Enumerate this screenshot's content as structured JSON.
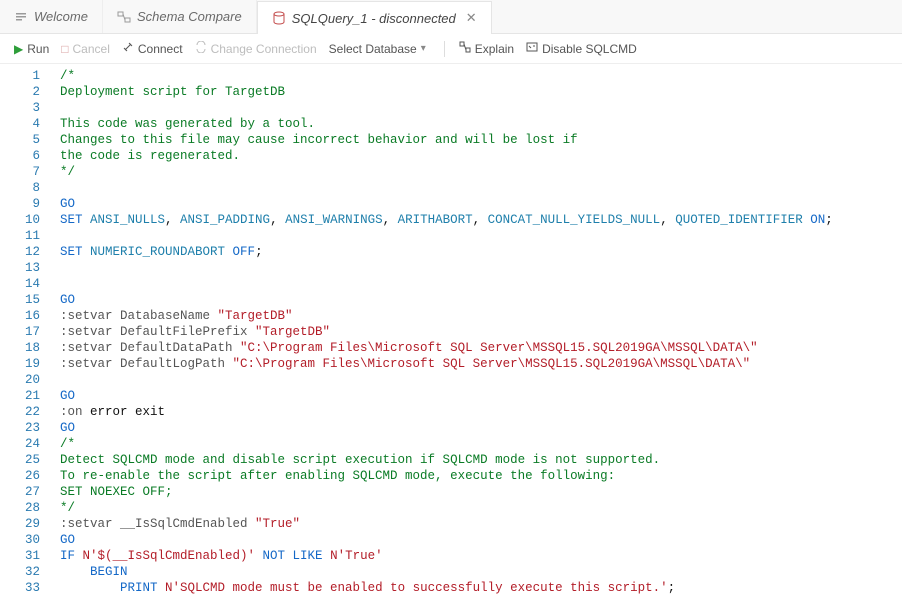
{
  "tabs": [
    {
      "label": "Welcome",
      "icon": "welcome"
    },
    {
      "label": "Schema Compare",
      "icon": "schema"
    },
    {
      "label": "SQLQuery_1 - disconnected",
      "icon": "db",
      "active": true,
      "closeable": true
    }
  ],
  "toolbar": {
    "run": "Run",
    "cancel": "Cancel",
    "connect": "Connect",
    "change_connection": "Change Connection",
    "select_database": "Select Database",
    "explain": "Explain",
    "disable_sqlcmd": "Disable SQLCMD"
  },
  "code_lines": [
    {
      "n": 1,
      "spans": [
        {
          "cls": "c-comment",
          "t": "/*"
        }
      ]
    },
    {
      "n": 2,
      "spans": [
        {
          "cls": "c-comment",
          "t": "Deployment script for TargetDB"
        }
      ]
    },
    {
      "n": 3,
      "spans": []
    },
    {
      "n": 4,
      "spans": [
        {
          "cls": "c-comment",
          "t": "This code was generated by a tool."
        }
      ]
    },
    {
      "n": 5,
      "spans": [
        {
          "cls": "c-comment",
          "t": "Changes to this file may cause incorrect behavior and will be lost if"
        }
      ]
    },
    {
      "n": 6,
      "spans": [
        {
          "cls": "c-comment",
          "t": "the code is regenerated."
        }
      ]
    },
    {
      "n": 7,
      "spans": [
        {
          "cls": "c-comment",
          "t": "*/"
        }
      ]
    },
    {
      "n": 8,
      "spans": []
    },
    {
      "n": 9,
      "spans": [
        {
          "cls": "c-kw",
          "t": "GO"
        }
      ]
    },
    {
      "n": 10,
      "spans": [
        {
          "cls": "c-kw",
          "t": "SET "
        },
        {
          "cls": "c-ident",
          "t": "ANSI_NULLS"
        },
        {
          "cls": "c-plain",
          "t": ", "
        },
        {
          "cls": "c-ident",
          "t": "ANSI_PADDING"
        },
        {
          "cls": "c-plain",
          "t": ", "
        },
        {
          "cls": "c-ident",
          "t": "ANSI_WARNINGS"
        },
        {
          "cls": "c-plain",
          "t": ", "
        },
        {
          "cls": "c-ident",
          "t": "ARITHABORT"
        },
        {
          "cls": "c-plain",
          "t": ", "
        },
        {
          "cls": "c-ident",
          "t": "CONCAT_NULL_YIELDS_NULL"
        },
        {
          "cls": "c-plain",
          "t": ", "
        },
        {
          "cls": "c-ident",
          "t": "QUOTED_IDENTIFIER"
        },
        {
          "cls": "c-kw",
          "t": " ON"
        },
        {
          "cls": "c-plain",
          "t": ";"
        }
      ]
    },
    {
      "n": 11,
      "spans": []
    },
    {
      "n": 12,
      "spans": [
        {
          "cls": "c-kw",
          "t": "SET "
        },
        {
          "cls": "c-ident",
          "t": "NUMERIC_ROUNDABORT"
        },
        {
          "cls": "c-kw",
          "t": " OFF"
        },
        {
          "cls": "c-plain",
          "t": ";"
        }
      ]
    },
    {
      "n": 13,
      "spans": []
    },
    {
      "n": 14,
      "spans": []
    },
    {
      "n": 15,
      "spans": [
        {
          "cls": "c-kw",
          "t": "GO"
        }
      ]
    },
    {
      "n": 16,
      "spans": [
        {
          "cls": "c-sqlcmd",
          "t": ":setvar DatabaseName "
        },
        {
          "cls": "c-str",
          "t": "\"TargetDB\""
        }
      ]
    },
    {
      "n": 17,
      "spans": [
        {
          "cls": "c-sqlcmd",
          "t": ":setvar DefaultFilePrefix "
        },
        {
          "cls": "c-str",
          "t": "\"TargetDB\""
        }
      ]
    },
    {
      "n": 18,
      "spans": [
        {
          "cls": "c-sqlcmd",
          "t": ":setvar DefaultDataPath "
        },
        {
          "cls": "c-str",
          "t": "\"C:\\Program Files\\Microsoft SQL Server\\MSSQL15.SQL2019GA\\MSSQL\\DATA\\\""
        }
      ]
    },
    {
      "n": 19,
      "spans": [
        {
          "cls": "c-sqlcmd",
          "t": ":setvar DefaultLogPath "
        },
        {
          "cls": "c-str",
          "t": "\"C:\\Program Files\\Microsoft SQL Server\\MSSQL15.SQL2019GA\\MSSQL\\DATA\\\""
        }
      ]
    },
    {
      "n": 20,
      "spans": []
    },
    {
      "n": 21,
      "spans": [
        {
          "cls": "c-kw",
          "t": "GO"
        }
      ]
    },
    {
      "n": 22,
      "spans": [
        {
          "cls": "c-sqlcmd",
          "t": ":on"
        },
        {
          "cls": "c-plain",
          "t": " error exit"
        }
      ]
    },
    {
      "n": 23,
      "spans": [
        {
          "cls": "c-kw",
          "t": "GO"
        }
      ]
    },
    {
      "n": 24,
      "spans": [
        {
          "cls": "c-comment",
          "t": "/*"
        }
      ]
    },
    {
      "n": 25,
      "spans": [
        {
          "cls": "c-comment",
          "t": "Detect SQLCMD mode and disable script execution if SQLCMD mode is not supported."
        }
      ]
    },
    {
      "n": 26,
      "spans": [
        {
          "cls": "c-comment",
          "t": "To re-enable the script after enabling SQLCMD mode, execute the following:"
        }
      ]
    },
    {
      "n": 27,
      "spans": [
        {
          "cls": "c-comment",
          "t": "SET NOEXEC OFF; "
        }
      ]
    },
    {
      "n": 28,
      "spans": [
        {
          "cls": "c-comment",
          "t": "*/"
        }
      ]
    },
    {
      "n": 29,
      "spans": [
        {
          "cls": "c-sqlcmd",
          "t": ":setvar __IsSqlCmdEnabled "
        },
        {
          "cls": "c-str",
          "t": "\"True\""
        }
      ]
    },
    {
      "n": 30,
      "spans": [
        {
          "cls": "c-kw",
          "t": "GO"
        }
      ]
    },
    {
      "n": 31,
      "spans": [
        {
          "cls": "c-kw",
          "t": "IF "
        },
        {
          "cls": "c-str",
          "t": "N'$(__IsSqlCmdEnabled)'"
        },
        {
          "cls": "c-kw",
          "t": " NOT LIKE "
        },
        {
          "cls": "c-str",
          "t": "N'True'"
        }
      ]
    },
    {
      "n": 32,
      "spans": [
        {
          "cls": "c-plain",
          "t": "    "
        },
        {
          "cls": "c-kw",
          "t": "BEGIN"
        }
      ]
    },
    {
      "n": 33,
      "spans": [
        {
          "cls": "c-plain",
          "t": "        "
        },
        {
          "cls": "c-kw",
          "t": "PRINT "
        },
        {
          "cls": "c-str",
          "t": "N'SQLCMD mode must be enabled to successfully execute this script.'"
        },
        {
          "cls": "c-plain",
          "t": ";"
        }
      ]
    }
  ]
}
